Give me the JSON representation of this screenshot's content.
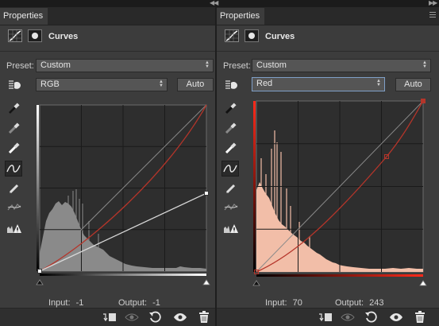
{
  "panels": [
    {
      "tab_label": "Properties",
      "title": "Curves",
      "preset_label": "Preset:",
      "preset_value": "Custom",
      "channel_value": "RGB",
      "auto_label": "Auto",
      "input_label": "Input:",
      "input_value": "-1",
      "output_label": "Output:",
      "output_value": "-1",
      "histogram_color": "#8a8a8a",
      "curve_color": "#b5352a"
    },
    {
      "tab_label": "Properties",
      "title": "Curves",
      "preset_label": "Preset:",
      "preset_value": "Custom",
      "channel_value": "Red",
      "auto_label": "Auto",
      "input_label": "Input:",
      "input_value": "70",
      "output_label": "Output:",
      "output_value": "243",
      "histogram_color": "#f2bea8",
      "curve_color": "#b5352a"
    }
  ],
  "icons": {
    "header": [
      "curves-adjustment-icon",
      "layer-mask-icon"
    ],
    "tools": [
      "on-image-adjust-icon",
      "black-point-eyedropper-icon",
      "gray-point-eyedropper-icon",
      "white-point-eyedropper-icon",
      "curve-points-icon",
      "pencil-draw-icon",
      "smooth-curve-icon",
      "clipping-warning-icon"
    ],
    "bottom": [
      "clip-to-layer-icon",
      "view-previous-state-icon",
      "reset-icon",
      "visibility-eye-icon",
      "delete-trash-icon"
    ]
  }
}
